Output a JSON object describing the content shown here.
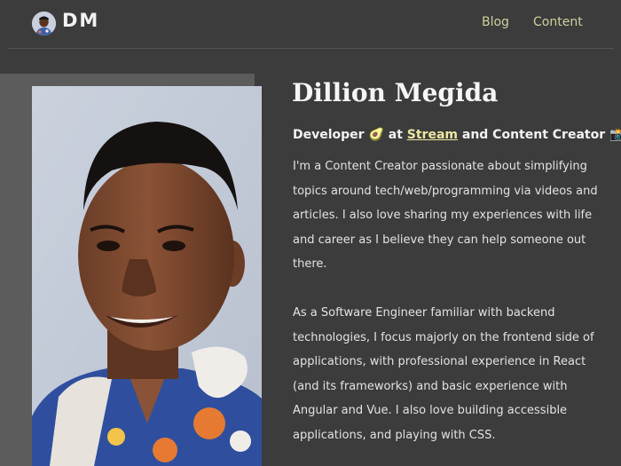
{
  "header": {
    "logo_text": "DM",
    "nav": [
      {
        "label": "Blog"
      },
      {
        "label": "Content"
      }
    ]
  },
  "profile": {
    "name": "Dillion Megida",
    "role": {
      "prefix": "Developer 🥑 at ",
      "company": "Stream",
      "suffix": " and Content Creator 📸"
    },
    "bio_paragraphs": [
      "I'm a Content Creator passionate about simplifying topics around tech/web/programming via videos and articles. I also love sharing my experiences with life and career as I believe they can help someone out there.",
      "As a Software Engineer familiar with backend technologies, I focus majorly on the frontend side of applications, with professional experience in React (and its frameworks) and basic experience with Angular and Vue. I also love building accessible applications, and playing with CSS."
    ]
  },
  "colors": {
    "background": "#3c3c3c",
    "accent": "#cfcf9e",
    "link": "#ece8a0",
    "photo_frame": "#5c5c5c"
  }
}
